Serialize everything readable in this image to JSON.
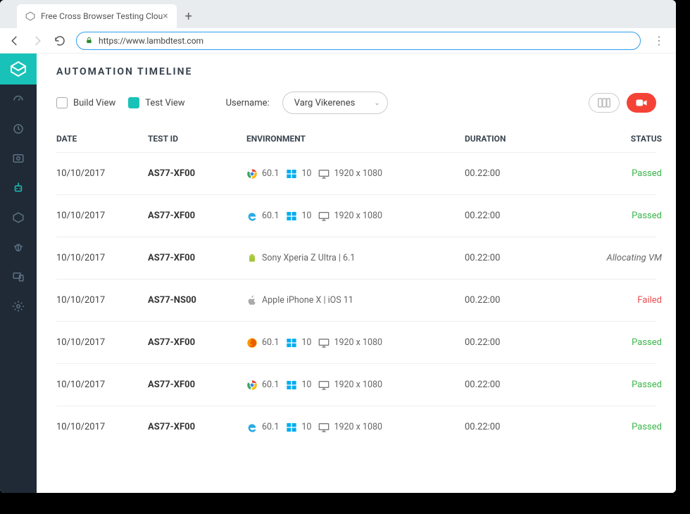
{
  "browser": {
    "tab_title": "Free Cross Browser Testing Clou",
    "url": "https://www.lambdtest.com"
  },
  "page": {
    "title": "AUTOMATION TIMELINE"
  },
  "toolbar": {
    "build_view_label": "Build View",
    "test_view_label": "Test View",
    "username_label": "Username:",
    "username_value": "Varg Vikerenes"
  },
  "columns": {
    "date": "DATE",
    "test_id": "TEST ID",
    "environment": "ENVIRONMENT",
    "duration": "DURATION",
    "status": "STATUS"
  },
  "rows": [
    {
      "date": "10/10/2017",
      "test_id": "AS77-XF00",
      "env_type": "desktop",
      "browser": "chrome",
      "browser_ver": "60.1",
      "os": "windows",
      "os_ver": "10",
      "res": "1920 x 1080",
      "duration": "00.22:00",
      "status": "Passed",
      "status_class": "passed"
    },
    {
      "date": "10/10/2017",
      "test_id": "AS77-XF00",
      "env_type": "desktop",
      "browser": "ie",
      "browser_ver": "60.1",
      "os": "windows",
      "os_ver": "10",
      "res": "1920 x 1080",
      "duration": "00.22:00",
      "status": "Passed",
      "status_class": "passed"
    },
    {
      "date": "10/10/2017",
      "test_id": "AS77-XF00",
      "env_type": "mobile",
      "platform": "android",
      "device_label": "Sony Xperia Z Ultra |  6.1",
      "duration": "00.22:00",
      "status": "Allocating VM",
      "status_class": "allocating"
    },
    {
      "date": "10/10/2017",
      "test_id": "AS77-NS00",
      "env_type": "mobile",
      "platform": "apple",
      "device_label": "Apple iPhone X | iOS 11",
      "duration": "00.22:00",
      "status": "Failed",
      "status_class": "failed"
    },
    {
      "date": "10/10/2017",
      "test_id": "AS77-XF00",
      "env_type": "desktop",
      "browser": "firefox",
      "browser_ver": "60.1",
      "os": "windows",
      "os_ver": "10",
      "res": "1920 x 1080",
      "duration": "00.22:00",
      "status": "Passed",
      "status_class": "passed"
    },
    {
      "date": "10/10/2017",
      "test_id": "AS77-XF00",
      "env_type": "desktop",
      "browser": "chrome",
      "browser_ver": "60.1",
      "os": "windows",
      "os_ver": "10",
      "res": "1920 x 1080",
      "duration": "00.22:00",
      "status": "Passed",
      "status_class": "passed"
    },
    {
      "date": "10/10/2017",
      "test_id": "AS77-XF00",
      "env_type": "desktop",
      "browser": "ie",
      "browser_ver": "60.1",
      "os": "windows",
      "os_ver": "10",
      "res": "1920 x 1080",
      "duration": "00.22:00",
      "status": "Passed",
      "status_class": "passed"
    }
  ]
}
